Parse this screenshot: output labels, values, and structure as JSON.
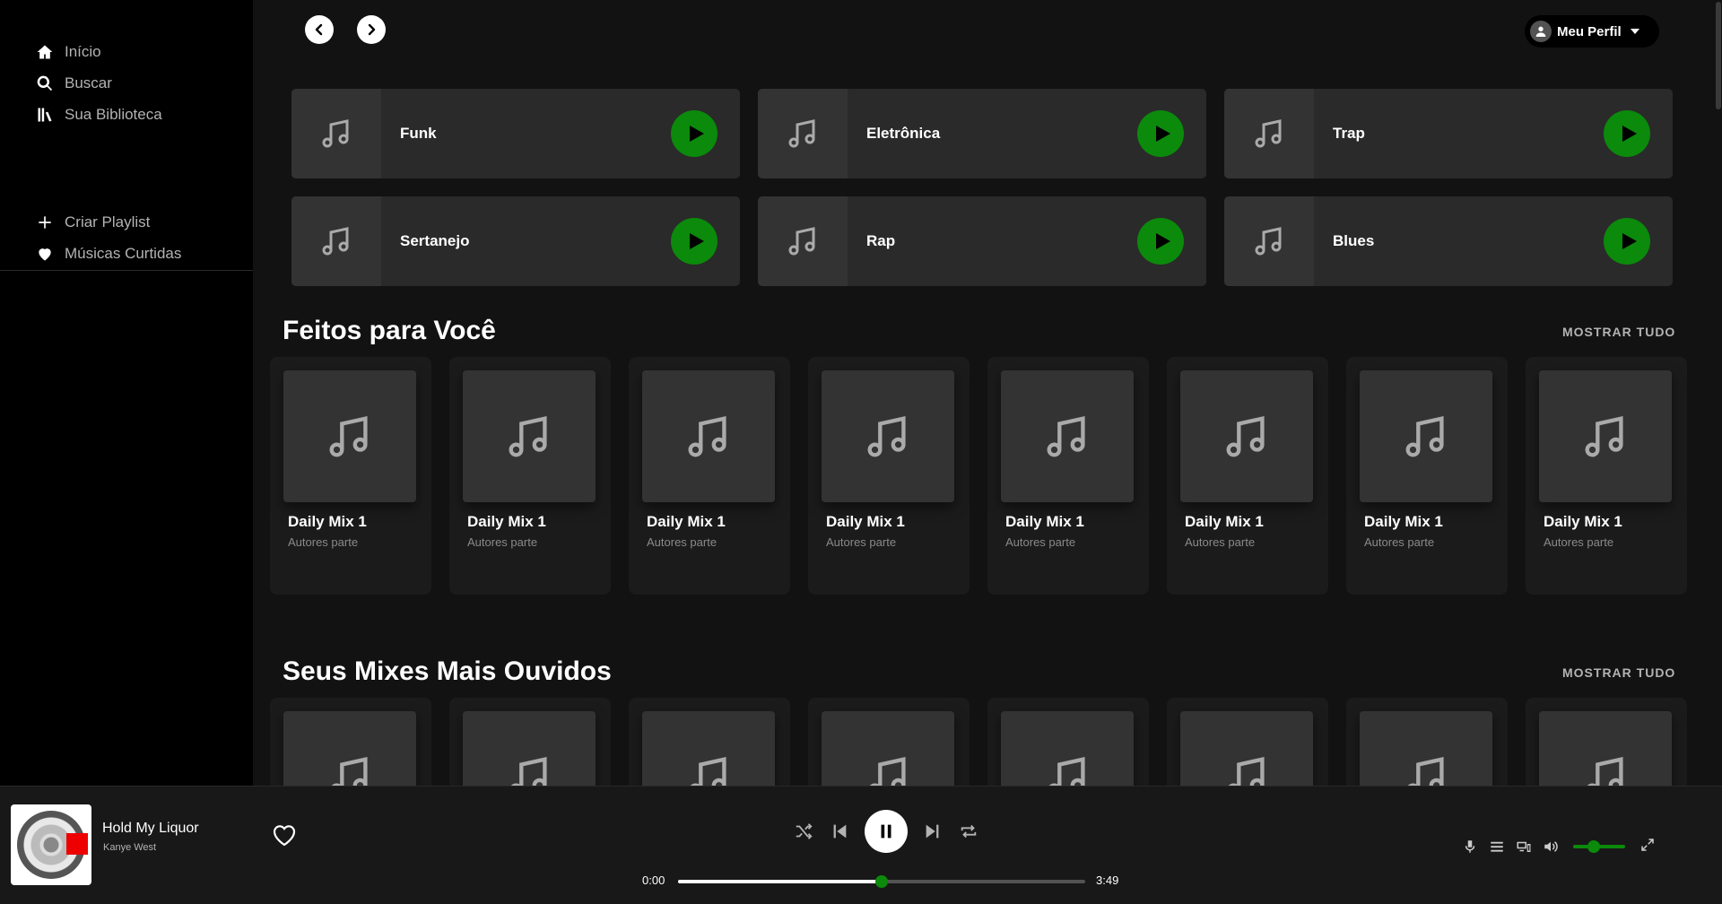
{
  "sidebar": {
    "nav": [
      {
        "label": "Início",
        "icon": "home-icon"
      },
      {
        "label": "Buscar",
        "icon": "search-icon"
      },
      {
        "label": "Sua Biblioteca",
        "icon": "library-icon"
      }
    ],
    "actions": [
      {
        "label": "Criar Playlist",
        "icon": "plus-icon"
      },
      {
        "label": "Músicas Curtidas",
        "icon": "heart-icon"
      }
    ]
  },
  "header": {
    "profile_label": "Meu Perfil"
  },
  "genres": [
    {
      "name": "Funk"
    },
    {
      "name": "Eletrônica"
    },
    {
      "name": "Trap"
    },
    {
      "name": "Sertanejo"
    },
    {
      "name": "Rap"
    },
    {
      "name": "Blues"
    }
  ],
  "sections": [
    {
      "title": "Feitos para Você",
      "show_all": "MOSTRAR TUDO",
      "cards": [
        {
          "title": "Daily Mix 1",
          "subtitle": "Autores parte"
        },
        {
          "title": "Daily Mix 1",
          "subtitle": "Autores parte"
        },
        {
          "title": "Daily Mix 1",
          "subtitle": "Autores parte"
        },
        {
          "title": "Daily Mix 1",
          "subtitle": "Autores parte"
        },
        {
          "title": "Daily Mix 1",
          "subtitle": "Autores parte"
        },
        {
          "title": "Daily Mix 1",
          "subtitle": "Autores parte"
        },
        {
          "title": "Daily Mix 1",
          "subtitle": "Autores parte"
        },
        {
          "title": "Daily Mix 1",
          "subtitle": "Autores parte"
        }
      ]
    },
    {
      "title": "Seus Mixes Mais Ouvidos",
      "show_all": "MOSTRAR TUDO",
      "cards": [
        {
          "title": "",
          "subtitle": ""
        },
        {
          "title": "",
          "subtitle": ""
        },
        {
          "title": "",
          "subtitle": ""
        },
        {
          "title": "",
          "subtitle": ""
        },
        {
          "title": "",
          "subtitle": ""
        },
        {
          "title": "",
          "subtitle": ""
        },
        {
          "title": "",
          "subtitle": ""
        },
        {
          "title": "",
          "subtitle": ""
        }
      ]
    }
  ],
  "player": {
    "track_title": "Hold My Liquor",
    "artist": "Kanye West",
    "current_time": "0:00",
    "duration": "3:49",
    "progress": 0.5,
    "volume": 0.4,
    "accent_color": "#0b8a0b"
  }
}
